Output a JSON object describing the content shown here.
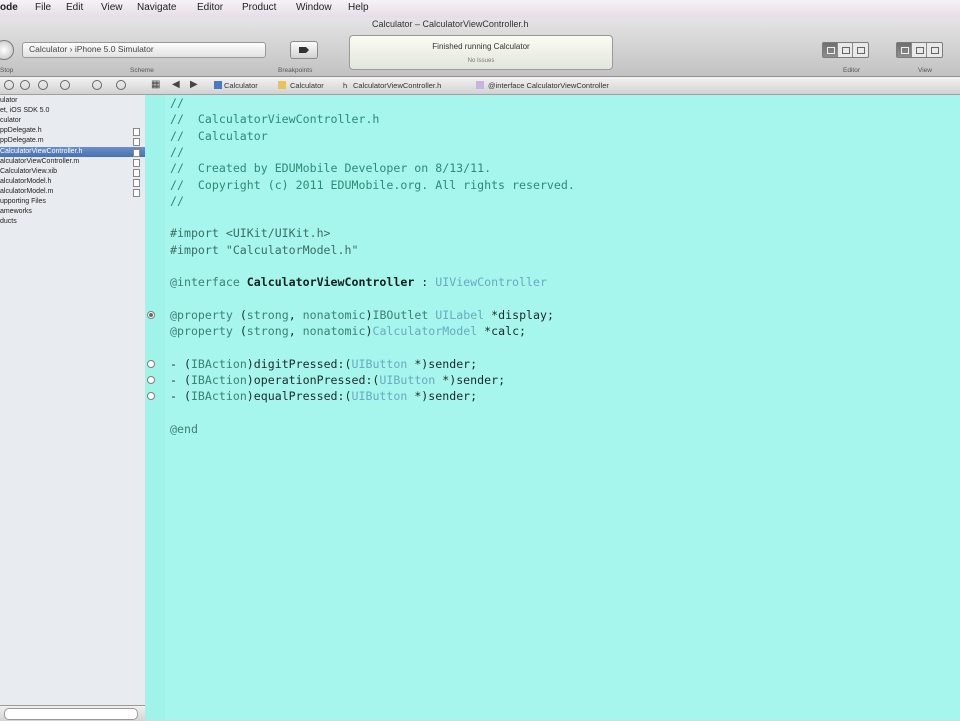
{
  "menubar": {
    "app": "ode",
    "items": [
      "File",
      "Edit",
      "View",
      "Navigate",
      "Editor",
      "Product",
      "Window",
      "Help"
    ]
  },
  "window": {
    "title": "Calculator – CalculatorViewController.h"
  },
  "toolbar": {
    "stop_label": "Stop",
    "scheme_value": "Calculator › iPhone 5.0 Simulator",
    "scheme_label": "Scheme",
    "breakpoints_label": "Breakpoints",
    "activity_message": "Finished running Calculator",
    "activity_sub": "No Issues",
    "editor_label": "Editor",
    "view_label": "View"
  },
  "jumpbar": {
    "crumbs": [
      "Calculator",
      "Calculator",
      "CalculatorViewController.h",
      "@interface CalculatorViewController"
    ]
  },
  "navigator": {
    "items": [
      {
        "label": "ulator",
        "badge": false,
        "selected": false
      },
      {
        "label": "et, iOS SDK 5.0",
        "badge": false,
        "selected": false
      },
      {
        "label": "culator",
        "badge": false,
        "selected": false
      },
      {
        "label": "ppDelegate.h",
        "badge": true,
        "selected": false
      },
      {
        "label": "ppDelegate.m",
        "badge": true,
        "selected": false
      },
      {
        "label": "CalculatorViewController.h",
        "badge": true,
        "selected": true
      },
      {
        "label": "alculatorViewController.m",
        "badge": true,
        "selected": false
      },
      {
        "label": "CalculatorView.xib",
        "badge": true,
        "selected": false
      },
      {
        "label": "alculatorModel.h",
        "badge": true,
        "selected": false
      },
      {
        "label": "alculatorModel.m",
        "badge": true,
        "selected": false
      },
      {
        "label": "upporting Files",
        "badge": false,
        "selected": false
      },
      {
        "label": "ameworks",
        "badge": false,
        "selected": false
      },
      {
        "label": "ducts",
        "badge": false,
        "selected": false
      }
    ]
  },
  "editor": {
    "filename": "CalculatorViewController.h",
    "lines": [
      [
        [
          "c-comment",
          "//"
        ]
      ],
      [
        [
          "c-comment",
          "//  CalculatorViewController.h"
        ]
      ],
      [
        [
          "c-comment",
          "//  Calculator"
        ]
      ],
      [
        [
          "c-comment",
          "//"
        ]
      ],
      [
        [
          "c-comment",
          "//  Created by EDUMobile Developer on 8/13/11."
        ]
      ],
      [
        [
          "c-comment",
          "//  Copyright (c) 2011 EDUMobile.org. All rights reserved."
        ]
      ],
      [
        [
          "c-comment",
          "//"
        ]
      ],
      [],
      [
        [
          "c-pre",
          "#import <UIKit/UIKit.h>"
        ]
      ],
      [
        [
          "c-pre",
          "#import \"CalculatorModel.h\""
        ]
      ],
      [],
      [
        [
          "c-kw",
          "@interface "
        ],
        [
          "c-bold",
          "CalculatorViewController"
        ],
        [
          "c-plain",
          " : "
        ],
        [
          "c-type",
          "UIViewController"
        ]
      ],
      [],
      [
        [
          "c-kw",
          "@property "
        ],
        [
          "c-plain",
          "("
        ],
        [
          "c-kw",
          "strong"
        ],
        [
          "c-plain",
          ", "
        ],
        [
          "c-kw",
          "nonatomic"
        ],
        [
          "c-plain",
          ")"
        ],
        [
          "c-kw",
          "IBOutlet "
        ],
        [
          "c-type",
          "UILabel"
        ],
        [
          "c-plain",
          " *display;"
        ]
      ],
      [
        [
          "c-kw",
          "@property "
        ],
        [
          "c-plain",
          "("
        ],
        [
          "c-kw",
          "strong"
        ],
        [
          "c-plain",
          ", "
        ],
        [
          "c-kw",
          "nonatomic"
        ],
        [
          "c-plain",
          ")"
        ],
        [
          "c-type",
          "CalculatorModel"
        ],
        [
          "c-plain",
          " *calc;"
        ]
      ],
      [],
      [
        [
          "c-plain",
          "- ("
        ],
        [
          "c-kw",
          "IBAction"
        ],
        [
          "c-plain",
          ")digitPressed:("
        ],
        [
          "c-type",
          "UIButton"
        ],
        [
          "c-plain",
          " *)sender;"
        ]
      ],
      [
        [
          "c-plain",
          "- ("
        ],
        [
          "c-kw",
          "IBAction"
        ],
        [
          "c-plain",
          ")operationPressed:("
        ],
        [
          "c-type",
          "UIButton"
        ],
        [
          "c-plain",
          " *)sender;"
        ]
      ],
      [
        [
          "c-plain",
          "- ("
        ],
        [
          "c-kw",
          "IBAction"
        ],
        [
          "c-plain",
          ")equalPressed:("
        ],
        [
          "c-type",
          "UIButton"
        ],
        [
          "c-plain",
          " *)sender;"
        ]
      ],
      [],
      [
        [
          "c-kw",
          "@end"
        ]
      ]
    ],
    "gutter_markers": [
      {
        "line": 13,
        "filled": true
      },
      {
        "line": 16,
        "filled": false
      },
      {
        "line": 17,
        "filled": false
      },
      {
        "line": 18,
        "filled": false
      }
    ]
  },
  "colors": {
    "editor_bg": "#a6f6ee",
    "comment": "#2e8a77",
    "selection": "#4671b4"
  }
}
